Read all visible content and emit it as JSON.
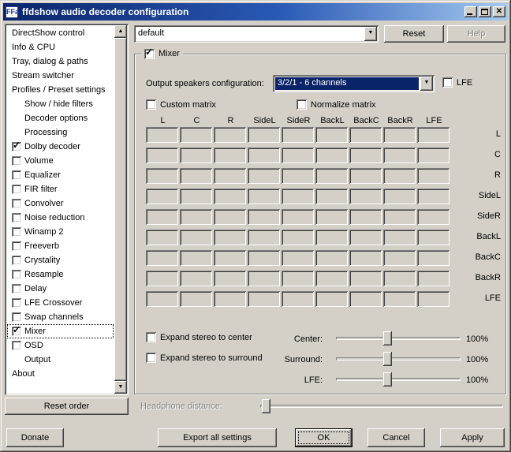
{
  "window": {
    "title": "ffdshow audio decoder configuration",
    "icon_text": "FFa"
  },
  "colors": {
    "dialog_bg": "#d4d0c8",
    "titlebar_start": "#0a246a",
    "titlebar_end": "#a6caf0",
    "selection": "#0a246a"
  },
  "topbar": {
    "preset_value": "default",
    "reset_label": "Reset",
    "help_label": "Help"
  },
  "sidebar": {
    "items": [
      {
        "label": "DirectShow control",
        "indent": 0
      },
      {
        "label": "Info & CPU",
        "indent": 0
      },
      {
        "label": "Tray, dialog & paths",
        "indent": 0
      },
      {
        "label": "Stream switcher",
        "indent": 0
      },
      {
        "label": "Profiles / Preset settings",
        "indent": 0
      },
      {
        "label": "Show / hide filters",
        "indent": 1
      },
      {
        "label": "Decoder options",
        "indent": 1
      },
      {
        "label": "Processing",
        "indent": 1
      },
      {
        "label": "Dolby decoder",
        "indent": 0,
        "checkbox": true,
        "checked": true
      },
      {
        "label": "Volume",
        "indent": 0,
        "checkbox": true,
        "checked": false
      },
      {
        "label": "Equalizer",
        "indent": 0,
        "checkbox": true,
        "checked": false
      },
      {
        "label": "FIR filter",
        "indent": 0,
        "checkbox": true,
        "checked": false
      },
      {
        "label": "Convolver",
        "indent": 0,
        "checkbox": true,
        "checked": false
      },
      {
        "label": "Noise reduction",
        "indent": 0,
        "checkbox": true,
        "checked": false
      },
      {
        "label": "Winamp 2",
        "indent": 0,
        "checkbox": true,
        "checked": false
      },
      {
        "label": "Freeverb",
        "indent": 0,
        "checkbox": true,
        "checked": false
      },
      {
        "label": "Crystality",
        "indent": 0,
        "checkbox": true,
        "checked": false
      },
      {
        "label": "Resample",
        "indent": 0,
        "checkbox": true,
        "checked": false
      },
      {
        "label": "Delay",
        "indent": 0,
        "checkbox": true,
        "checked": false
      },
      {
        "label": "LFE Crossover",
        "indent": 0,
        "checkbox": true,
        "checked": false
      },
      {
        "label": "Swap channels",
        "indent": 0,
        "checkbox": true,
        "checked": false
      },
      {
        "label": "Mixer",
        "indent": 0,
        "checkbox": true,
        "checked": true,
        "selected": true
      },
      {
        "label": "OSD",
        "indent": 0,
        "checkbox": true,
        "checked": false
      },
      {
        "label": "Output",
        "indent": 1
      },
      {
        "label": "About",
        "indent": 0
      }
    ],
    "reset_order_label": "Reset order"
  },
  "mixer": {
    "group_label": "Mixer",
    "group_checked": true,
    "output_label": "Output speakers configuration:",
    "output_value": "3/2/1 - 6 channels",
    "lfe_label": "LFE",
    "lfe_checked": false,
    "custom_matrix_label": "Custom matrix",
    "custom_matrix_checked": false,
    "normalize_matrix_label": "Normalize matrix",
    "normalize_matrix_checked": false,
    "channels": [
      "L",
      "C",
      "R",
      "SideL",
      "SideR",
      "BackL",
      "BackC",
      "BackR",
      "LFE"
    ],
    "expand_center_label": "Expand stereo to center",
    "expand_center_checked": false,
    "expand_surround_label": "Expand stereo to surround",
    "expand_surround_checked": false,
    "center_label": "Center:",
    "center_value": "100%",
    "surround_label": "Surround:",
    "surround_value": "100%",
    "lfe_slider_label": "LFE:",
    "lfe_value": "100%",
    "headphone_label": "Headphone distance:"
  },
  "buttons": {
    "donate": "Donate",
    "export": "Export all settings",
    "ok": "OK",
    "cancel": "Cancel",
    "apply": "Apply"
  }
}
